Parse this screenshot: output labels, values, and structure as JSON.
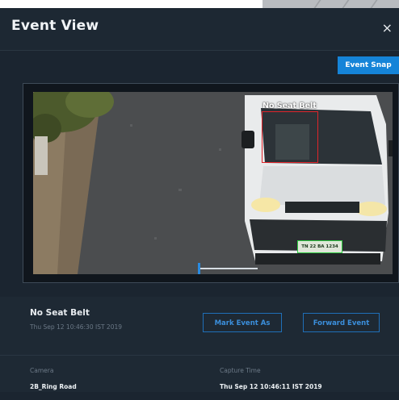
{
  "modal": {
    "title": "Event View",
    "close_icon": "close-icon",
    "close_glyph": "×"
  },
  "toolbar": {
    "event_snap_label": "Event Snap"
  },
  "viewer": {
    "detection_label": "No Seat Belt",
    "plate_text": "TN 22 BA 1234",
    "scrubber_progress": 0.02,
    "colors": {
      "detection_box": "#e0242a",
      "plate_box": "#2ecc40",
      "scrubber_handle": "#2a8be0"
    }
  },
  "event": {
    "type": "No Seat Belt",
    "timestamp": "Thu Sep 12 10:46:30 IST 2019",
    "mark_event_label": "Mark Event As",
    "forward_event_label": "Forward Event"
  },
  "details": {
    "camera_label": "Camera",
    "camera_value": "2B_Ring Road",
    "capture_time_label": "Capture Time",
    "capture_time_value": "Thu Sep 12 10:46:11 IST 2019"
  },
  "colors": {
    "accent": "#1584d8",
    "modal_bg": "#1b2530",
    "outline_button": "#1f6fb8"
  }
}
